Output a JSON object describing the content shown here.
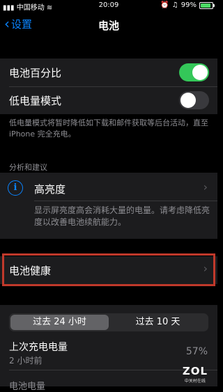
{
  "status_bar": {
    "carrier": "中国移动",
    "time": "20:09",
    "battery_percent": "99%",
    "battery_level": 0.99,
    "icons": [
      "signal-icon",
      "wifi-icon",
      "alarm-icon",
      "headphones-icon",
      "battery-icon"
    ]
  },
  "nav": {
    "back_label": "设置",
    "title": "电池"
  },
  "battery_settings": {
    "percentage_label": "电池百分比",
    "percentage_on": true,
    "low_power_label": "低电量模式",
    "low_power_on": false,
    "low_power_note": "低电量模式将暂时降低如下载和邮件获取等后台活动，直至 iPhone 完全充电。"
  },
  "insights": {
    "header": "分析和建议",
    "item_label": "高亮度",
    "item_note": "显示屏亮度高会消耗大量的电量。请考虑降低亮度以改善电池续航能力。"
  },
  "health": {
    "label": "电池健康"
  },
  "usage": {
    "tabs": [
      "过去 24 小时",
      "过去 10 天"
    ],
    "selected_tab": 0,
    "last_charge_label": "上次充电电量",
    "last_charge_time": "2 小时前",
    "last_charge_value": "57%",
    "next_label": "电池电量"
  },
  "watermark": {
    "brand": "ZOL",
    "sub": "中关村在线"
  },
  "colors": {
    "accent": "#0a84ff",
    "toggle_on": "#34c759",
    "highlight_border": "#c0392b"
  }
}
